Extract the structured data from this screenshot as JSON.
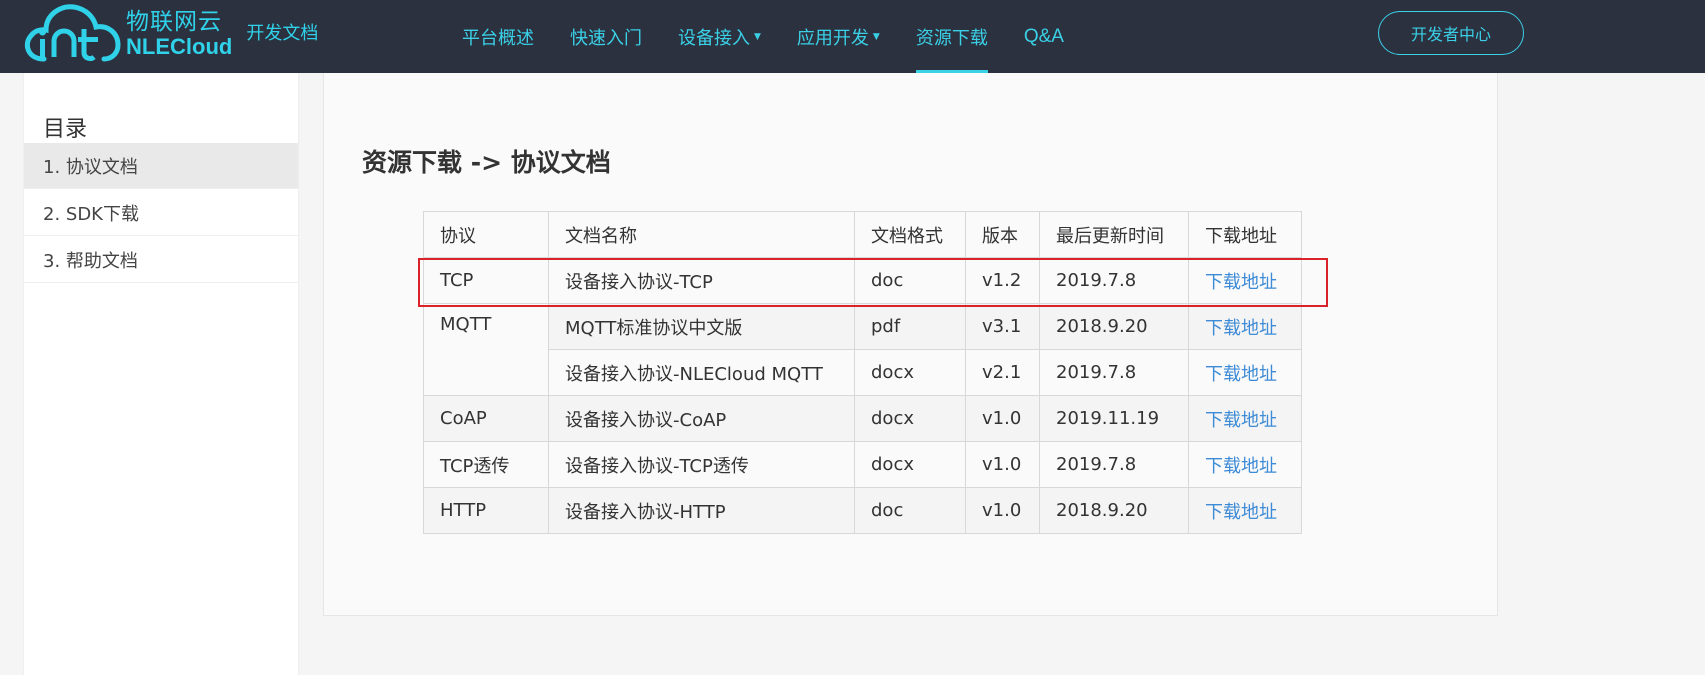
{
  "header": {
    "logo_cn": "物联网云",
    "logo_en": "NLECloud",
    "logo_sub": "开发文档",
    "nav": [
      {
        "label": "平台概述",
        "caret": false,
        "active": false
      },
      {
        "label": "快速入门",
        "caret": false,
        "active": false
      },
      {
        "label": "设备接入",
        "caret": true,
        "active": false
      },
      {
        "label": "应用开发",
        "caret": true,
        "active": false
      },
      {
        "label": "资源下载",
        "caret": false,
        "active": true
      },
      {
        "label": "Q&A",
        "caret": false,
        "active": false
      }
    ],
    "dev_center": "开发者中心"
  },
  "sidebar": {
    "title": "目录",
    "items": [
      {
        "label": "1. 协议文档",
        "active": true
      },
      {
        "label": "2. SDK下载",
        "active": false
      },
      {
        "label": "3. 帮助文档",
        "active": false
      }
    ]
  },
  "main": {
    "heading": "资源下载 -> 协议文档",
    "table": {
      "headers": [
        "协议",
        "文档名称",
        "文档格式",
        "版本",
        "最后更新时间",
        "下载地址"
      ],
      "rows": [
        {
          "protocol": "TCP",
          "name": "设备接入协议-TCP",
          "format": "doc",
          "version": "v1.2",
          "updated": "2019.7.8",
          "link": "下载地址"
        },
        {
          "protocol": "MQTT",
          "name": "MQTT标准协议中文版",
          "format": "pdf",
          "version": "v3.1",
          "updated": "2018.9.20",
          "link": "下载地址"
        },
        {
          "protocol": "",
          "name": "设备接入协议-NLECloud MQTT",
          "format": "docx",
          "version": "v2.1",
          "updated": "2019.7.8",
          "link": "下载地址"
        },
        {
          "protocol": "CoAP",
          "name": "设备接入协议-CoAP",
          "format": "docx",
          "version": "v1.0",
          "updated": "2019.11.19",
          "link": "下载地址"
        },
        {
          "protocol": "TCP透传",
          "name": "设备接入协议-TCP透传",
          "format": "docx",
          "version": "v1.0",
          "updated": "2019.7.8",
          "link": "下载地址"
        },
        {
          "protocol": "HTTP",
          "name": "设备接入协议-HTTP",
          "format": "doc",
          "version": "v1.0",
          "updated": "2018.9.20",
          "link": "下载地址"
        }
      ]
    }
  },
  "colors": {
    "header_bg": "#2c3140",
    "accent": "#3ad0e6",
    "link": "#3d8bd6",
    "highlight": "#d9222a"
  }
}
